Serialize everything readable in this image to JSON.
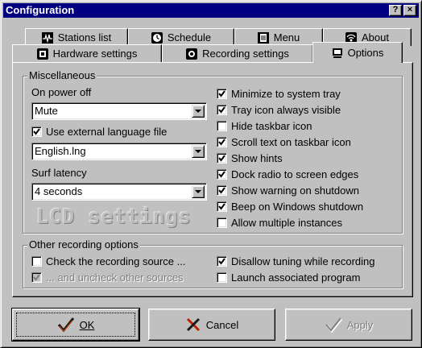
{
  "window": {
    "title": "Configuration",
    "help_button": "?",
    "close_button": "×"
  },
  "tabs": {
    "row1": [
      {
        "label": "Stations list",
        "icon": "pulse-icon"
      },
      {
        "label": "Schedule",
        "icon": "clock-icon"
      },
      {
        "label": "Menu",
        "icon": "menu-icon"
      },
      {
        "label": "About",
        "icon": "radio-waves-icon"
      }
    ],
    "row2": [
      {
        "label": "Hardware settings",
        "icon": "hardware-icon"
      },
      {
        "label": "Recording settings",
        "icon": "record-icon"
      },
      {
        "label": "Options",
        "icon": "monitor-icon",
        "active": true
      }
    ]
  },
  "misc": {
    "title": "Miscellaneous",
    "power_off_label": "On power off",
    "power_off_value": "Mute",
    "use_language_label": "Use external language file",
    "use_language_checked": true,
    "language_value": "English.lng",
    "surf_latency_label": "Surf latency",
    "surf_latency_value": "4 seconds",
    "lcd_settings": "LCD settings",
    "options": [
      {
        "label": "Minimize to system tray",
        "checked": true
      },
      {
        "label": "Tray icon always visible",
        "checked": true
      },
      {
        "label": "Hide taskbar icon",
        "checked": false
      },
      {
        "label": "Scroll text on taskbar icon",
        "checked": true
      },
      {
        "label": "Show hints",
        "checked": true
      },
      {
        "label": "Dock radio to screen edges",
        "checked": true
      },
      {
        "label": "Show warning on shutdown",
        "checked": true
      },
      {
        "label": "Beep on Windows shutdown",
        "checked": true
      },
      {
        "label": "Allow multiple instances",
        "checked": false
      }
    ]
  },
  "recording": {
    "title": "Other recording options",
    "check_source": {
      "label": "Check the recording source ...",
      "checked": false
    },
    "uncheck_other": {
      "label": "... and uncheck other sources",
      "checked": true,
      "disabled": true
    },
    "disallow_tuning": {
      "label": "Disallow tuning while recording",
      "checked": true
    },
    "launch_program": {
      "label": "Launch associated program",
      "checked": false
    }
  },
  "buttons": {
    "ok": "OK",
    "cancel": "Cancel",
    "apply": "Apply"
  },
  "colors": {
    "face": "#c0c0c0",
    "titlebar": "#000080"
  }
}
